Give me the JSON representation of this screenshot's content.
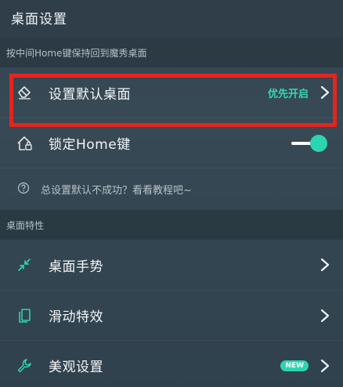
{
  "header": {
    "title": "桌面设置"
  },
  "section1": {
    "header": "按中间Home键保持回到魔秀桌面",
    "default_launcher": {
      "label": "设置默认桌面",
      "status": "优先开启",
      "icon": "eraser-icon"
    },
    "lock_home": {
      "label": "锁定Home键",
      "icon": "home-lock-icon",
      "enabled": true
    },
    "help": {
      "text": "总设置默认不成功？看看教程吧~",
      "icon": "question-circle-icon"
    }
  },
  "section2": {
    "header": "桌面特性",
    "items": [
      {
        "label": "桌面手势",
        "icon": "compress-arrows-icon"
      },
      {
        "label": "滑动特效",
        "icon": "copy-pages-icon"
      },
      {
        "label": "美观设置",
        "icon": "wrench-icon",
        "badge": "NEW"
      }
    ]
  },
  "colors": {
    "accent": "#2bd5b0",
    "highlight_border": "#e5241f"
  }
}
